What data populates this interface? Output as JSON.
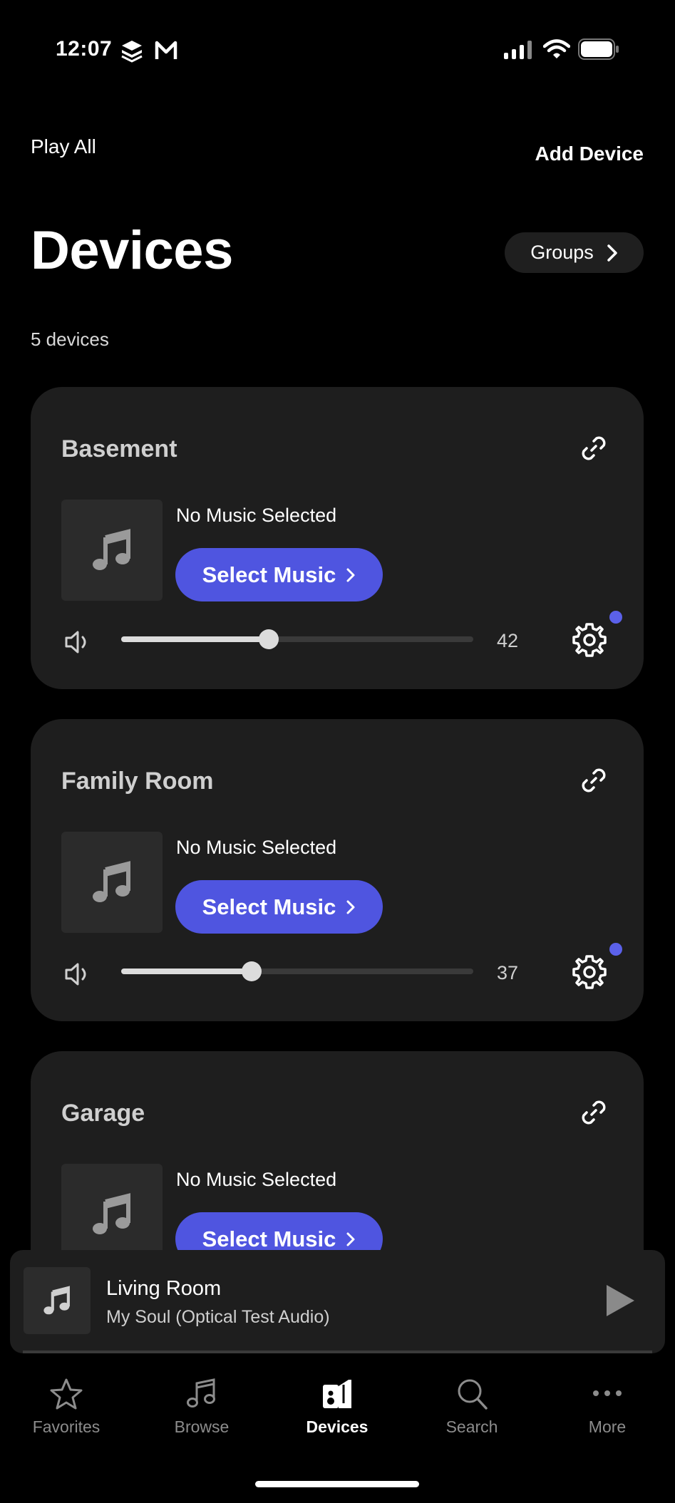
{
  "status_bar": {
    "time": "12:07"
  },
  "header": {
    "play_all": "Play All",
    "add_device": "Add Device",
    "title": "Devices",
    "groups_label": "Groups",
    "device_count": "5 devices"
  },
  "cards": [
    {
      "name": "Basement",
      "status": "No Music Selected",
      "select_label": "Select Music",
      "volume": "42",
      "volume_level": 0.42
    },
    {
      "name": "Family Room",
      "status": "No Music Selected",
      "select_label": "Select Music",
      "volume": "37",
      "volume_level": 0.37
    },
    {
      "name": "Garage",
      "status": "No Music Selected",
      "select_label": "Select Music"
    }
  ],
  "mini_player": {
    "room": "Living Room",
    "track": "My Soul (Optical Test Audio)"
  },
  "tabs": [
    {
      "label": "Favorites",
      "icon": "star-icon"
    },
    {
      "label": "Browse",
      "icon": "music-note-icon"
    },
    {
      "label": "Devices",
      "icon": "speaker-icon"
    },
    {
      "label": "Search",
      "icon": "search-icon"
    },
    {
      "label": "More",
      "icon": "more-dots-icon"
    }
  ],
  "colors": {
    "accent": "#4f55e0",
    "card": "#1e1e1e",
    "background": "#000000"
  }
}
